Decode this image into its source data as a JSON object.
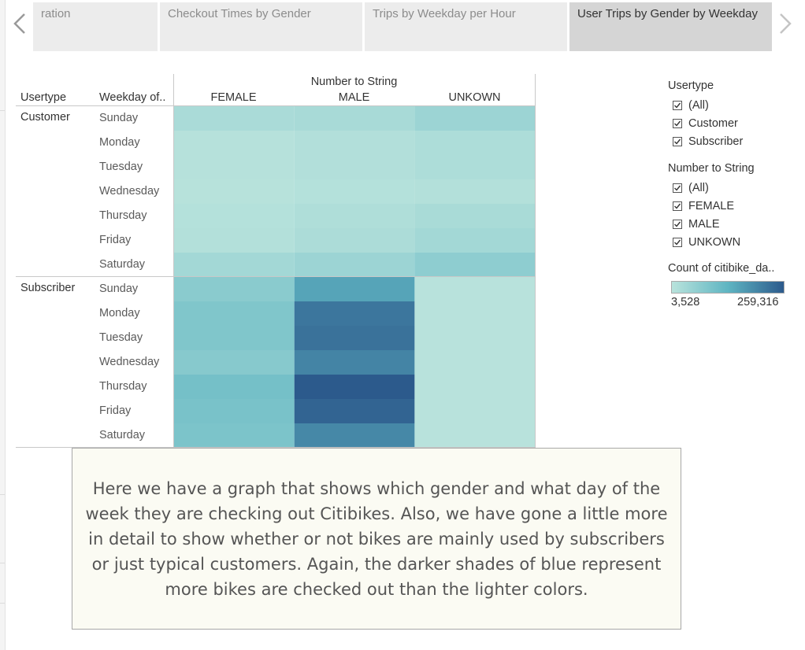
{
  "story": {
    "tabs": [
      {
        "label": "ration",
        "active": false
      },
      {
        "label": "Checkout Times by Gender",
        "active": false
      },
      {
        "label": "Trips by Weekday per Hour",
        "active": false
      },
      {
        "label": "User Trips by Gender by Weekday",
        "active": true
      }
    ],
    "prev_icon": "chevron-left-icon",
    "next_icon": "chevron-right-icon"
  },
  "table": {
    "row_header_1": "Usertype",
    "row_header_2": "Weekday of..",
    "column_group_title": "Number to String",
    "columns": [
      "FEMALE",
      "MALE",
      "UNKOWN"
    ],
    "weekdays": [
      "Sunday",
      "Monday",
      "Tuesday",
      "Wednesday",
      "Thursday",
      "Friday",
      "Saturday"
    ],
    "groups": [
      "Customer",
      "Subscriber"
    ]
  },
  "chart_data": {
    "type": "heatmap",
    "title": "",
    "row_dimensions": [
      "Usertype",
      "Weekday of.."
    ],
    "column_dimension": "Number to String",
    "columns": [
      "FEMALE",
      "MALE",
      "UNKOWN"
    ],
    "measure": "Count of citibike_da..",
    "color_range": [
      3528,
      259316
    ],
    "color_ramp": [
      "#b9e3dc",
      "#5fb5c2",
      "#2c5a8c"
    ],
    "rows": [
      {
        "usertype": "Customer",
        "weekday": "Sunday",
        "values": [
          25000,
          28000,
          45000
        ]
      },
      {
        "usertype": "Customer",
        "weekday": "Monday",
        "values": [
          8000,
          14000,
          20000
        ]
      },
      {
        "usertype": "Customer",
        "weekday": "Tuesday",
        "values": [
          8000,
          14000,
          20000
        ]
      },
      {
        "usertype": "Customer",
        "weekday": "Wednesday",
        "values": [
          6000,
          10000,
          12000
        ]
      },
      {
        "usertype": "Customer",
        "weekday": "Thursday",
        "values": [
          10000,
          18000,
          26000
        ]
      },
      {
        "usertype": "Customer",
        "weekday": "Friday",
        "values": [
          12000,
          22000,
          35000
        ]
      },
      {
        "usertype": "Customer",
        "weekday": "Saturday",
        "values": [
          35000,
          45000,
          65000
        ]
      },
      {
        "usertype": "Subscriber",
        "weekday": "Sunday",
        "values": [
          70000,
          155000,
          5000
        ]
      },
      {
        "usertype": "Subscriber",
        "weekday": "Monday",
        "values": [
          85000,
          220000,
          5000
        ]
      },
      {
        "usertype": "Subscriber",
        "weekday": "Tuesday",
        "values": [
          85000,
          225000,
          5000
        ]
      },
      {
        "usertype": "Subscriber",
        "weekday": "Wednesday",
        "values": [
          75000,
          200000,
          5000
        ]
      },
      {
        "usertype": "Subscriber",
        "weekday": "Thursday",
        "values": [
          100000,
          259316,
          5000
        ]
      },
      {
        "usertype": "Subscriber",
        "weekday": "Friday",
        "values": [
          95000,
          245000,
          5000
        ]
      },
      {
        "usertype": "Subscriber",
        "weekday": "Saturday",
        "values": [
          90000,
          195000,
          5000
        ]
      }
    ]
  },
  "legend": {
    "usertype": {
      "title": "Usertype",
      "items": [
        "(All)",
        "Customer",
        "Subscriber"
      ]
    },
    "gender": {
      "title": "Number to String",
      "items": [
        "(All)",
        "FEMALE",
        "MALE",
        "UNKOWN"
      ]
    },
    "color": {
      "title": "Count of citibike_da..",
      "min_label": "3,528",
      "max_label": "259,316"
    }
  },
  "annotation": {
    "text": "Here we have a graph that shows which gender and what day of the week they are checking out Citibikes. Also, we have gone a little more in detail to show whether or not bikes are mainly used by subscribers or just typical customers. Again, the darker shades of blue represent more bikes are checked out than the lighter colors."
  }
}
